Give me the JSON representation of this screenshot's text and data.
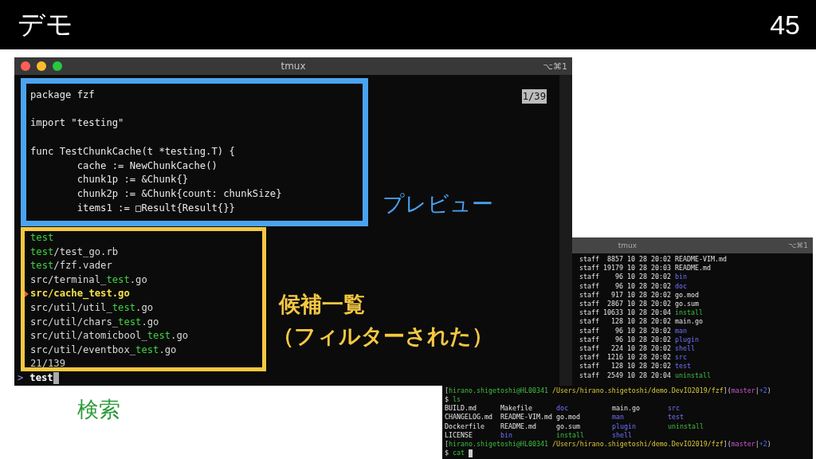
{
  "slide": {
    "title": "デモ",
    "page_number": "45"
  },
  "main_window": {
    "title": "tmux",
    "shortcut": "⌥⌘1",
    "preview": {
      "code": "package fzf\n\nimport \"testing\"\n\nfunc TestChunkCache(t *testing.T) {\n\tcache := NewChunkCache()\n\tchunk1p := &Chunk{}\n\tchunk2p := &Chunk{count: chunkSize}\n\titems1 := □Result{Result{}}",
      "counter": "1/39"
    },
    "items": [
      {
        "selected": false,
        "match": "test"
      },
      {
        "selected": false,
        "match": "test",
        "after": "/test_go.rb"
      },
      {
        "selected": false,
        "match": "test",
        "after": "/fzf.vader"
      },
      {
        "selected": false,
        "before": "src/terminal_",
        "match": "test",
        "after": ".go"
      },
      {
        "selected": true,
        "before": "src/cache_",
        "match": "test",
        "after": ".go"
      },
      {
        "selected": false,
        "before": "src/util/util_",
        "match": "test",
        "after": ".go"
      },
      {
        "selected": false,
        "before": "src/util/chars_",
        "match": "test",
        "after": ".go"
      },
      {
        "selected": false,
        "before": "src/util/atomicbool_",
        "match": "test",
        "after": ".go"
      },
      {
        "selected": false,
        "before": "src/util/eventbox_",
        "match": "test",
        "after": ".go"
      }
    ],
    "count": "21/139",
    "query": {
      "prompt": ">",
      "value": "test"
    }
  },
  "annotations": {
    "preview_label": "プレビュー",
    "list_label": "候補一覧",
    "list_note": "（フィルターされた）",
    "search_label": "検索"
  },
  "back_window": {
    "title": "tmux",
    "shortcut": "⌥⌘1",
    "listing": [
      {
        "owner": "staff",
        "size": "8857",
        "date": "10 28 20:02",
        "name": "README-VIM.md",
        "kind": "file"
      },
      {
        "owner": "staff",
        "size": "19179",
        "date": "10 28 20:03",
        "name": "README.md",
        "kind": "file"
      },
      {
        "owner": "staff",
        "size": "96",
        "date": "10 28 20:02",
        "name": "bin",
        "kind": "dir"
      },
      {
        "owner": "staff",
        "size": "96",
        "date": "10 28 20:02",
        "name": "doc",
        "kind": "dir"
      },
      {
        "owner": "staff",
        "size": "917",
        "date": "10 28 20:02",
        "name": "go.mod",
        "kind": "file"
      },
      {
        "owner": "staff",
        "size": "2867",
        "date": "10 28 20:02",
        "name": "go.sum",
        "kind": "file"
      },
      {
        "owner": "staff",
        "size": "10633",
        "date": "10 28 20:04",
        "name": "install",
        "kind": "exec"
      },
      {
        "owner": "staff",
        "size": "128",
        "date": "10 28 20:02",
        "name": "main.go",
        "kind": "file"
      },
      {
        "owner": "staff",
        "size": "96",
        "date": "10 28 20:02",
        "name": "man",
        "kind": "dir"
      },
      {
        "owner": "staff",
        "size": "96",
        "date": "10 28 20:02",
        "name": "plugin",
        "kind": "dir"
      },
      {
        "owner": "staff",
        "size": "224",
        "date": "10 28 20:02",
        "name": "shell",
        "kind": "dir"
      },
      {
        "owner": "staff",
        "size": "1216",
        "date": "10 28 20:02",
        "name": "src",
        "kind": "dir"
      },
      {
        "owner": "staff",
        "size": "128",
        "date": "10 28 20:02",
        "name": "test",
        "kind": "dir"
      },
      {
        "owner": "staff",
        "size": "2549",
        "date": "10 28 20:04",
        "name": "uninstall",
        "kind": "exec"
      }
    ],
    "blocks": [
      {
        "kind": "prompt",
        "segments": [
          {
            "text": "[",
            "kind": "bracket"
          },
          {
            "text": "hirano.shigetoshi@HL00341",
            "kind": "user"
          },
          {
            "text": " /Users/hirano.shigetoshi/demo.DevIO2019/fzf",
            "kind": "path"
          },
          {
            "text": "]",
            "kind": "bracket"
          },
          {
            "text": "(",
            "kind": "bracket"
          },
          {
            "text": "master",
            "kind": "branch"
          },
          {
            "text": "|",
            "kind": "bracket"
          },
          {
            "text": "+2",
            "kind": "changes"
          },
          {
            "text": ")",
            "kind": "bracket"
          }
        ]
      },
      {
        "kind": "command",
        "symbol": "$",
        "command": "ls",
        "cursor": false
      },
      {
        "kind": "grid",
        "rows": [
          [
            {
              "name": "BUILD.md",
              "kind": "file"
            },
            {
              "name": "Makefile",
              "kind": "file"
            },
            {
              "name": "doc",
              "kind": "dir"
            },
            {
              "name": "main.go",
              "kind": "file"
            },
            {
              "name": "src",
              "kind": "dir"
            }
          ],
          [
            {
              "name": "CHANGELOG.md",
              "kind": "file"
            },
            {
              "name": "README-VIM.md",
              "kind": "file"
            },
            {
              "name": "go.mod",
              "kind": "file"
            },
            {
              "name": "man",
              "kind": "dir"
            },
            {
              "name": "test",
              "kind": "dir"
            }
          ],
          [
            {
              "name": "Dockerfile",
              "kind": "file"
            },
            {
              "name": "README.md",
              "kind": "file"
            },
            {
              "name": "go.sum",
              "kind": "file"
            },
            {
              "name": "plugin",
              "kind": "dir"
            },
            {
              "name": "uninstall",
              "kind": "exec"
            }
          ],
          [
            {
              "name": "LICENSE",
              "kind": "file"
            },
            {
              "name": "bin",
              "kind": "dir"
            },
            {
              "name": "install",
              "kind": "exec"
            },
            {
              "name": "shell",
              "kind": "dir"
            }
          ]
        ]
      },
      {
        "kind": "prompt",
        "segments": [
          {
            "text": "[",
            "kind": "bracket"
          },
          {
            "text": "hirano.shigetoshi@HL00341",
            "kind": "user"
          },
          {
            "text": " /Users/hirano.shigetoshi/demo.DevIO2019/fzf",
            "kind": "path"
          },
          {
            "text": "]",
            "kind": "bracket"
          },
          {
            "text": "(",
            "kind": "bracket"
          },
          {
            "text": "master",
            "kind": "branch"
          },
          {
            "text": "|",
            "kind": "bracket"
          },
          {
            "text": "+2",
            "kind": "changes"
          },
          {
            "text": ")",
            "kind": "bracket"
          }
        ]
      },
      {
        "kind": "command",
        "symbol": "$",
        "command": "cat",
        "cursor": true
      }
    ]
  }
}
